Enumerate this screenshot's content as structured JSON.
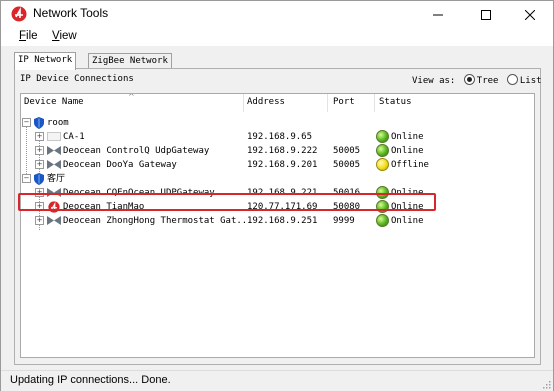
{
  "window": {
    "title": "Network Tools",
    "accent_color": "#d8262a",
    "controls": [
      "minimize-icon",
      "maximize-icon",
      "close-icon"
    ]
  },
  "menu": {
    "file_prefix": "F",
    "file_rest": "ile",
    "view_prefix": "V",
    "view_rest": "iew"
  },
  "tabs": [
    {
      "label": "IP Network",
      "active": true
    },
    {
      "label": "ZigBee Network",
      "active": false
    }
  ],
  "panel": {
    "title": "IP Device Connections",
    "view_as_label": "View as:",
    "view_options": [
      {
        "label": "Tree",
        "selected": true
      },
      {
        "label": "List",
        "selected": false
      }
    ]
  },
  "table": {
    "columns": [
      "Device Name",
      "Address",
      "Port",
      "Status"
    ],
    "rows": [
      {
        "kind": "group",
        "name": "room",
        "icon": "shield-icon"
      },
      {
        "kind": "device",
        "name": "CA-1",
        "address": "192.168.9.65",
        "port": "",
        "status": "Online",
        "icon": "device-box-icon"
      },
      {
        "kind": "device",
        "name": "Deocean ControlQ UdpGateway",
        "address": "192.168.9.222",
        "port": "50005",
        "status": "Online",
        "icon": "gateway-icon"
      },
      {
        "kind": "device",
        "name": "Deocean DooYa Gateway",
        "address": "192.168.9.201",
        "port": "50005",
        "status": "Offline",
        "icon": "gateway-icon"
      },
      {
        "kind": "group",
        "name": "客厅",
        "icon": "shield-icon"
      },
      {
        "kind": "device",
        "name": "Deocean CQEnOcean UDPGateway",
        "address": "192.168.9.221",
        "port": "50016",
        "status": "Online",
        "icon": "gateway-icon"
      },
      {
        "kind": "device",
        "name": "Deocean TianMao",
        "address": "120.77.171.69",
        "port": "50080",
        "status": "Online",
        "icon": "app-logo-icon",
        "highlighted": true
      },
      {
        "kind": "device",
        "name": "Deocean ZhongHong Thermostat Gat...",
        "address": "192.168.9.251",
        "port": "9999",
        "status": "Online",
        "icon": "gateway-icon"
      }
    ]
  },
  "statusbar": {
    "text": "Updating IP connections... Done."
  }
}
